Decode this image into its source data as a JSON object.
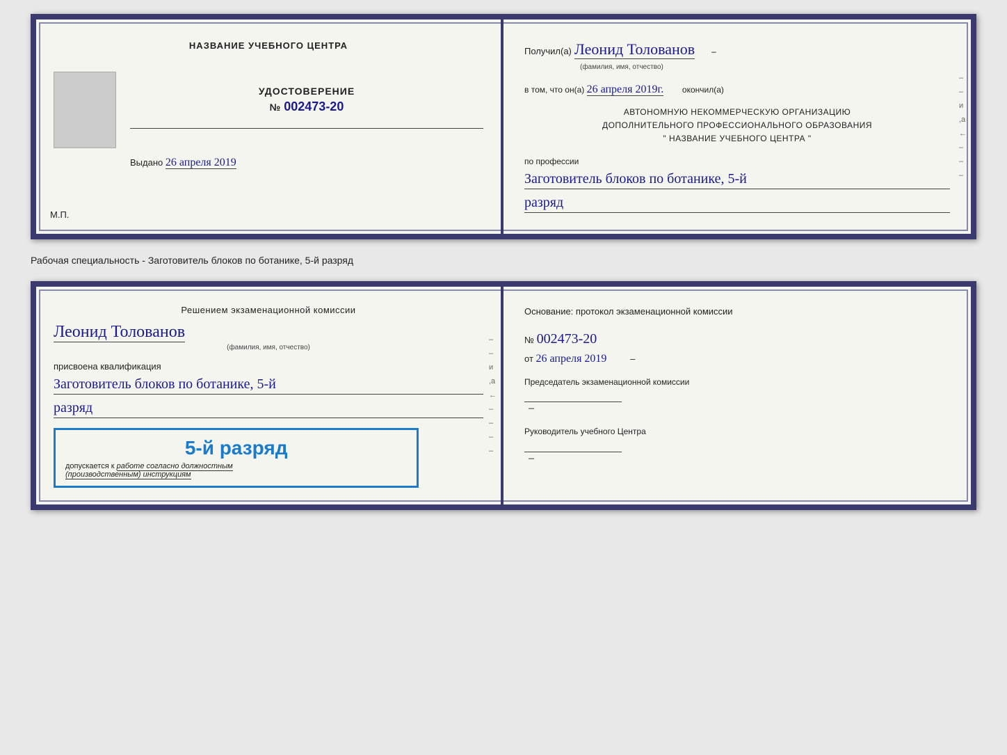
{
  "top_cert": {
    "left": {
      "section_title": "НАЗВАНИЕ УЧЕБНОГО ЦЕНТРА",
      "cert_label": "УДОСТОВЕРЕНИЕ",
      "cert_number_prefix": "№",
      "cert_number": "002473-20",
      "issued_label": "Выдано",
      "issued_date": "26 апреля 2019",
      "mp_label": "М.П."
    },
    "right": {
      "recipient_prefix": "Получил(а)",
      "recipient_name": "Леонид Толованов",
      "recipient_sublabel": "(фамилия, имя, отчество)",
      "body1": "в том, что он(а)",
      "date_handwritten": "26 апреля 2019г.",
      "finished_label": "окончил(а)",
      "org_line1": "АВТОНОМНУЮ НЕКОММЕРЧЕСКУЮ ОРГАНИЗАЦИЮ",
      "org_line2": "ДОПОЛНИТЕЛЬНОГО ПРОФЕССИОНАЛЬНОГО ОБРАЗОВАНИЯ",
      "org_line3": "\"   НАЗВАНИЕ УЧЕБНОГО ЦЕНТРА   \"",
      "profession_label": "по профессии",
      "profession_handwritten": "Заготовитель блоков по ботанике, 5-й",
      "rank_handwritten": "разряд"
    }
  },
  "separator_text": "Рабочая специальность - Заготовитель блоков по ботанике, 5-й разряд",
  "bottom_cert": {
    "left": {
      "decision_text": "Решением экзаменационной комиссии",
      "person_name": "Леонид Толованов",
      "person_sublabel": "(фамилия, имя, отчество)",
      "qualification_label": "присвоена квалификация",
      "qualification_handwritten": "Заготовитель блоков по ботанике, 5-й",
      "rank_handwritten": "разряд",
      "stamp_rank": "5-й разряд",
      "stamp_allowed_prefix": "допускается к",
      "stamp_italic": "работе согласно должностным",
      "stamp_italic2": "(производственным) инструкциям"
    },
    "right": {
      "basis_label": "Основание: протокол экзаменационной комиссии",
      "protocol_number_prefix": "№",
      "protocol_number": "002473-20",
      "date_prefix": "от",
      "date_value": "26 апреля 2019",
      "chairman_title": "Председатель экзаменационной комиссии",
      "director_title": "Руководитель учебного Центра"
    }
  },
  "side_marks": {
    "items": [
      "и",
      "а",
      "←",
      "–",
      "–",
      "–",
      "–",
      "–"
    ]
  }
}
